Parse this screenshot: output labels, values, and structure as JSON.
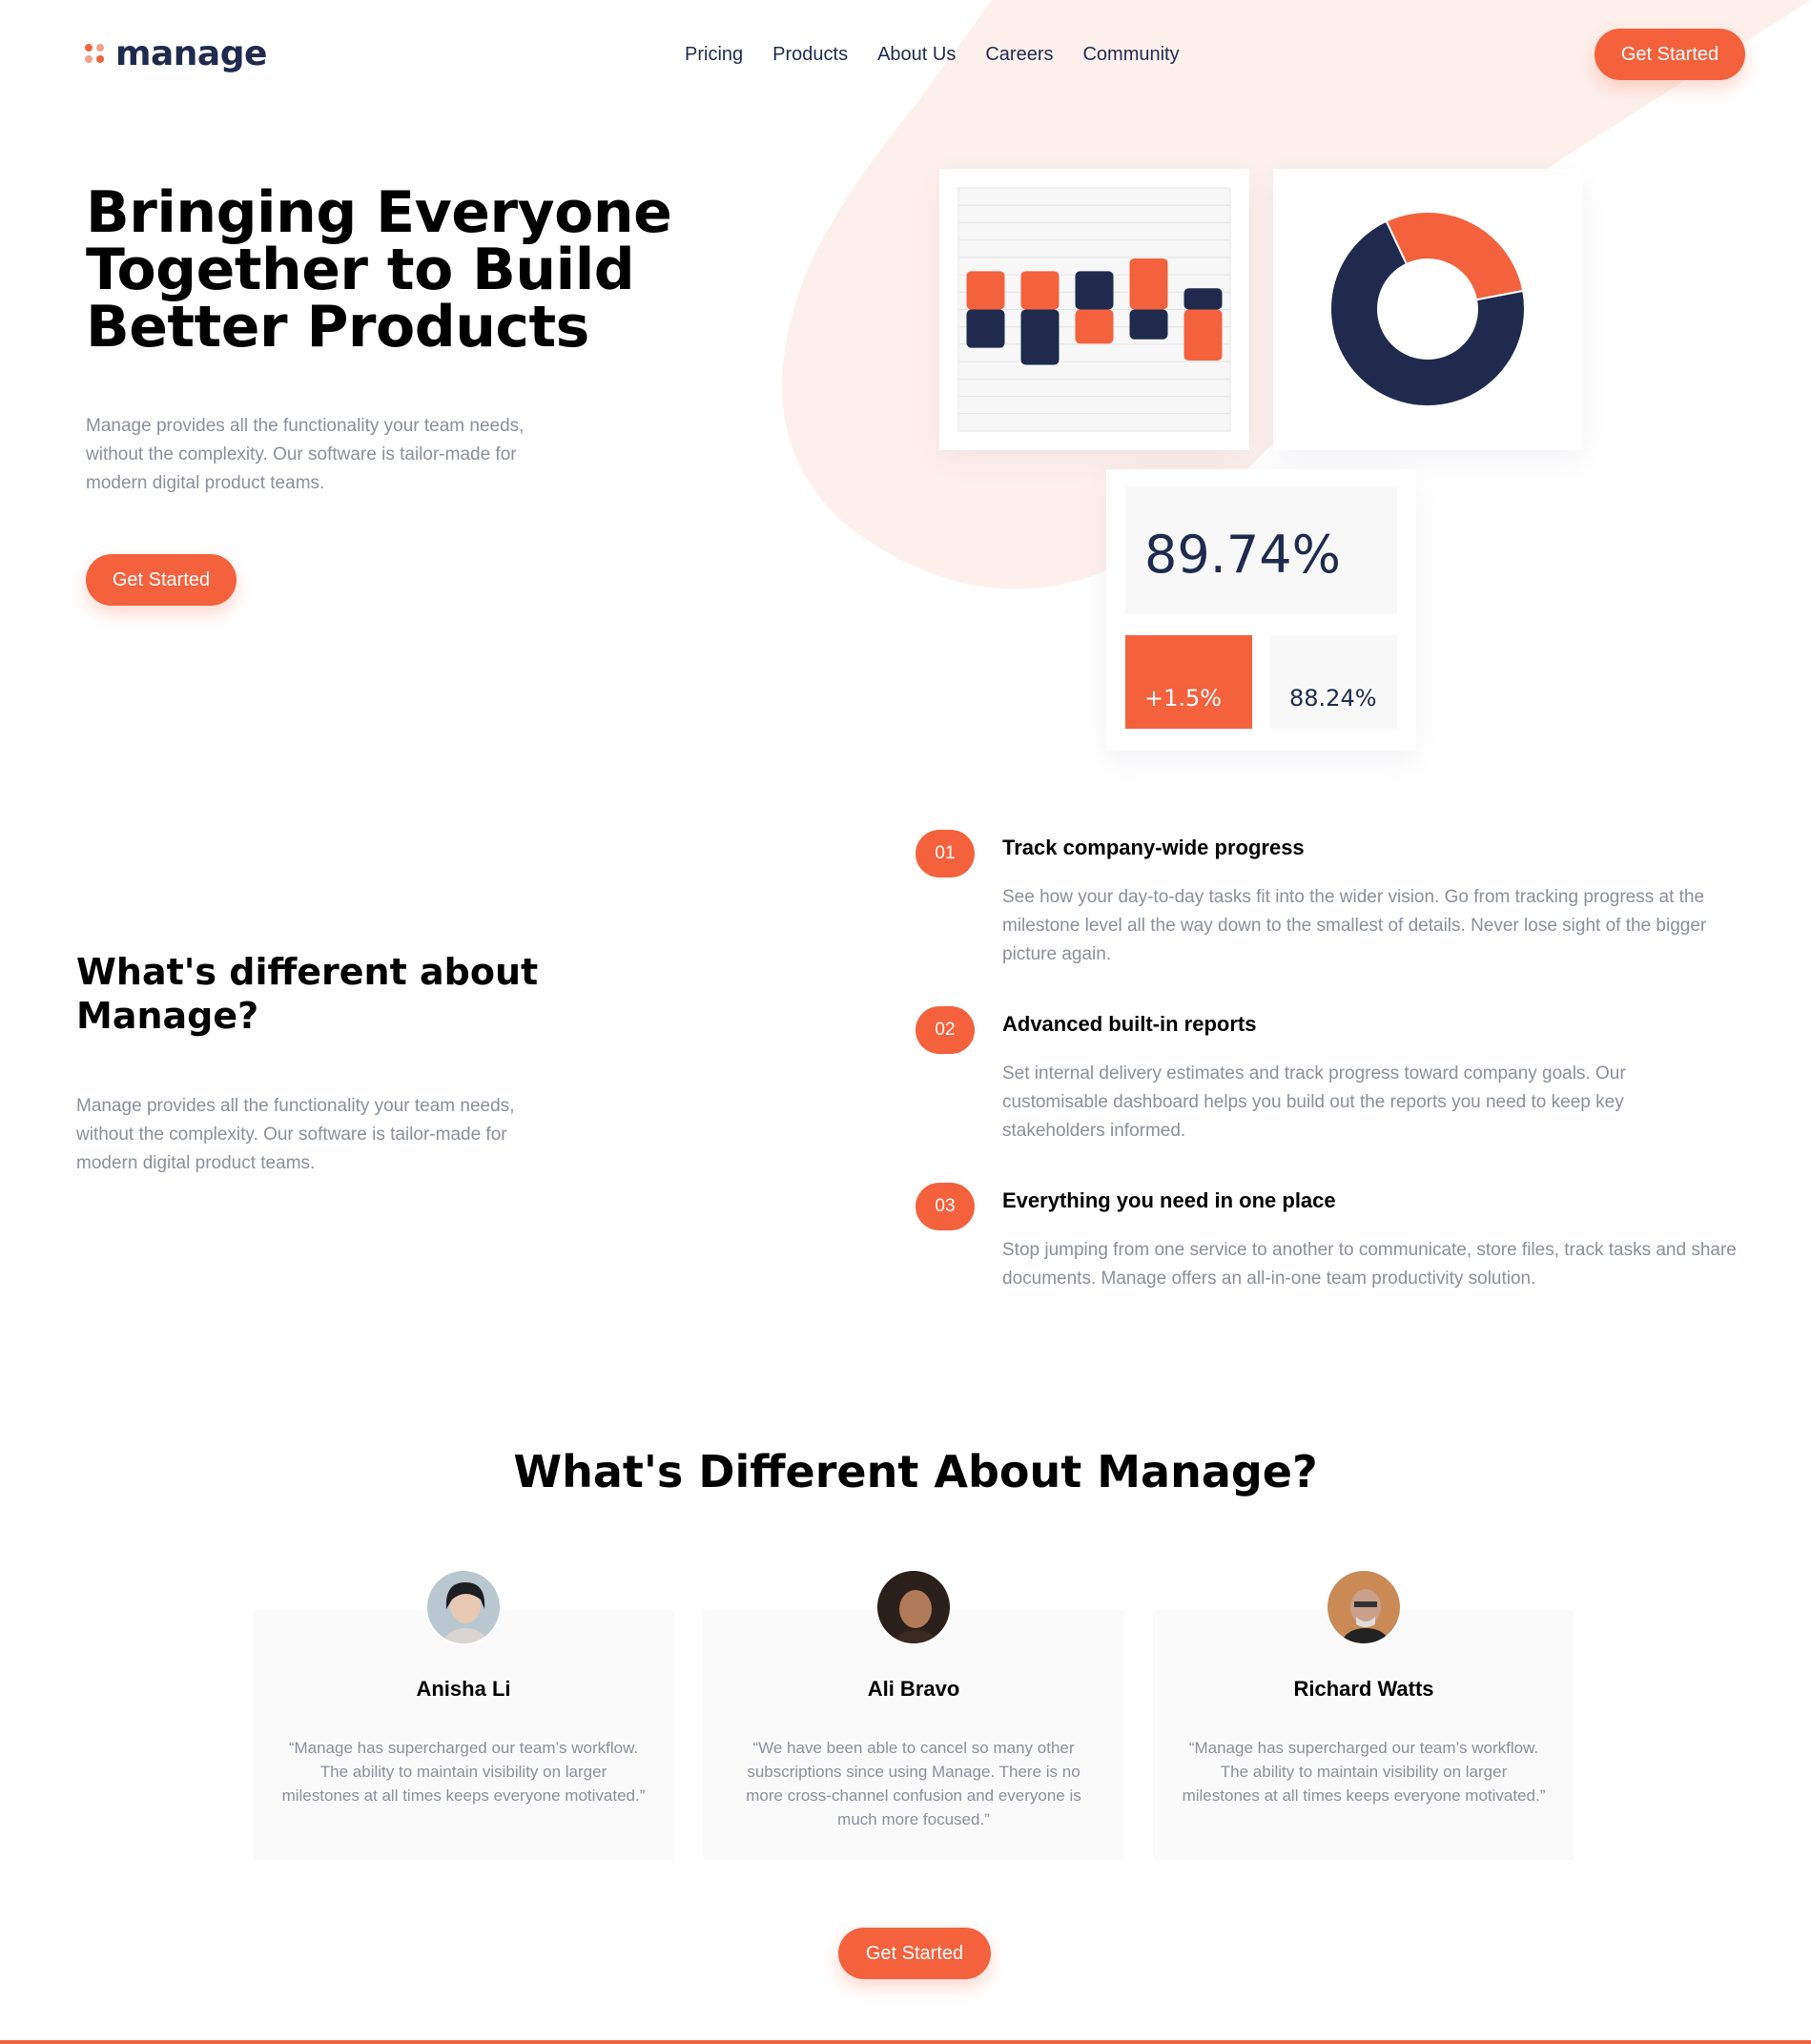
{
  "brand": {
    "name": "manage",
    "accent": "#f3613d",
    "navy": "#1f2a4e",
    "muted": "#8a8f99",
    "blob": "#fdf0ec"
  },
  "nav": {
    "items": [
      "Pricing",
      "Products",
      "About Us",
      "Careers",
      "Community"
    ],
    "cta": "Get Started"
  },
  "hero": {
    "title": "Bringing Everyone Together to Build Better Products",
    "text": "Manage provides all the functionality your team needs, without the complexity. Our software is tailor-made for modern digital product teams.",
    "cta": "Get Started"
  },
  "stats": {
    "main": "89.74%",
    "change": "+1.5%",
    "secondary": "88.24%"
  },
  "chart_data": [
    {
      "type": "bar",
      "series": [
        {
          "values": [
            0.45,
            0.45,
            -0.4,
            0.6,
            -0.6
          ]
        },
        {
          "values": [
            -0.45,
            -0.65,
            0.45,
            -0.35,
            0.25
          ]
        }
      ]
    },
    {
      "type": "pie",
      "values": [
        29,
        71
      ],
      "colors": [
        "#f3613d",
        "#1f2a4e"
      ]
    }
  ],
  "about": {
    "title": "What's different about Manage?",
    "text": "Manage provides all the functionality your team needs, without the complexity. Our software is tailor-made for modern digital product teams."
  },
  "features": [
    {
      "num": "01",
      "title": "Track company-wide progress",
      "text": "See how your day-to-day tasks fit into the wider vision. Go from tracking progress at the milestone level all the way down to the smallest of details. Never lose sight of the bigger picture again."
    },
    {
      "num": "02",
      "title": "Advanced built-in reports",
      "text": "Set internal delivery estimates and track progress toward company goals. Our customisable dashboard helps you build out the reports you need to keep key stakeholders informed."
    },
    {
      "num": "03",
      "title": "Everything you need in one place",
      "text": "Stop jumping from one service to another to communicate, store files, track tasks and share documents. Manage offers an all-in-one team productivity solution."
    }
  ],
  "testimonials": {
    "title": "What's Different About Manage?",
    "items": [
      {
        "name": "Anisha Li",
        "quote": "“Manage has supercharged our team’s workflow. The ability to maintain visibility on larger milestones at all times keeps everyone motivated.”"
      },
      {
        "name": "Ali Bravo",
        "quote": "“We have been able to cancel so many other subscriptions since using Manage. There is no more cross-channel confusion and everyone is much more focused.”"
      },
      {
        "name": "Richard Watts",
        "quote": "“Manage has supercharged our team’s workflow. The ability to maintain visibility on larger milestones at all times keeps everyone motivated.”"
      }
    ],
    "cta": "Get Started"
  }
}
